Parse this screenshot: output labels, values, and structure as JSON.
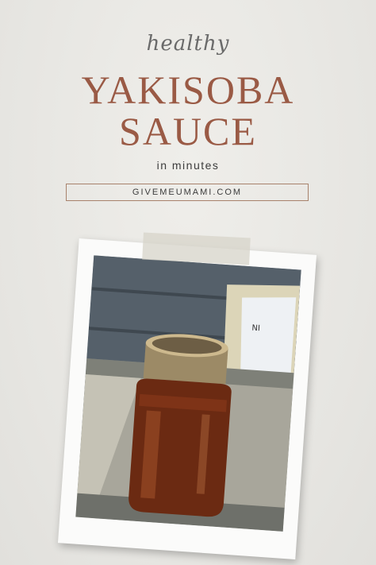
{
  "pin": {
    "tagline": "healthy",
    "title_line1": "YAKISOBA",
    "title_line2": "SAUCE",
    "subtitle": "in minutes",
    "website": "GIVEMEUMAMI.COM"
  },
  "colors": {
    "background": "#e9e8e4",
    "title": "#9a5a45",
    "box_border": "#a8826c",
    "sauce": "#6b2a12"
  }
}
